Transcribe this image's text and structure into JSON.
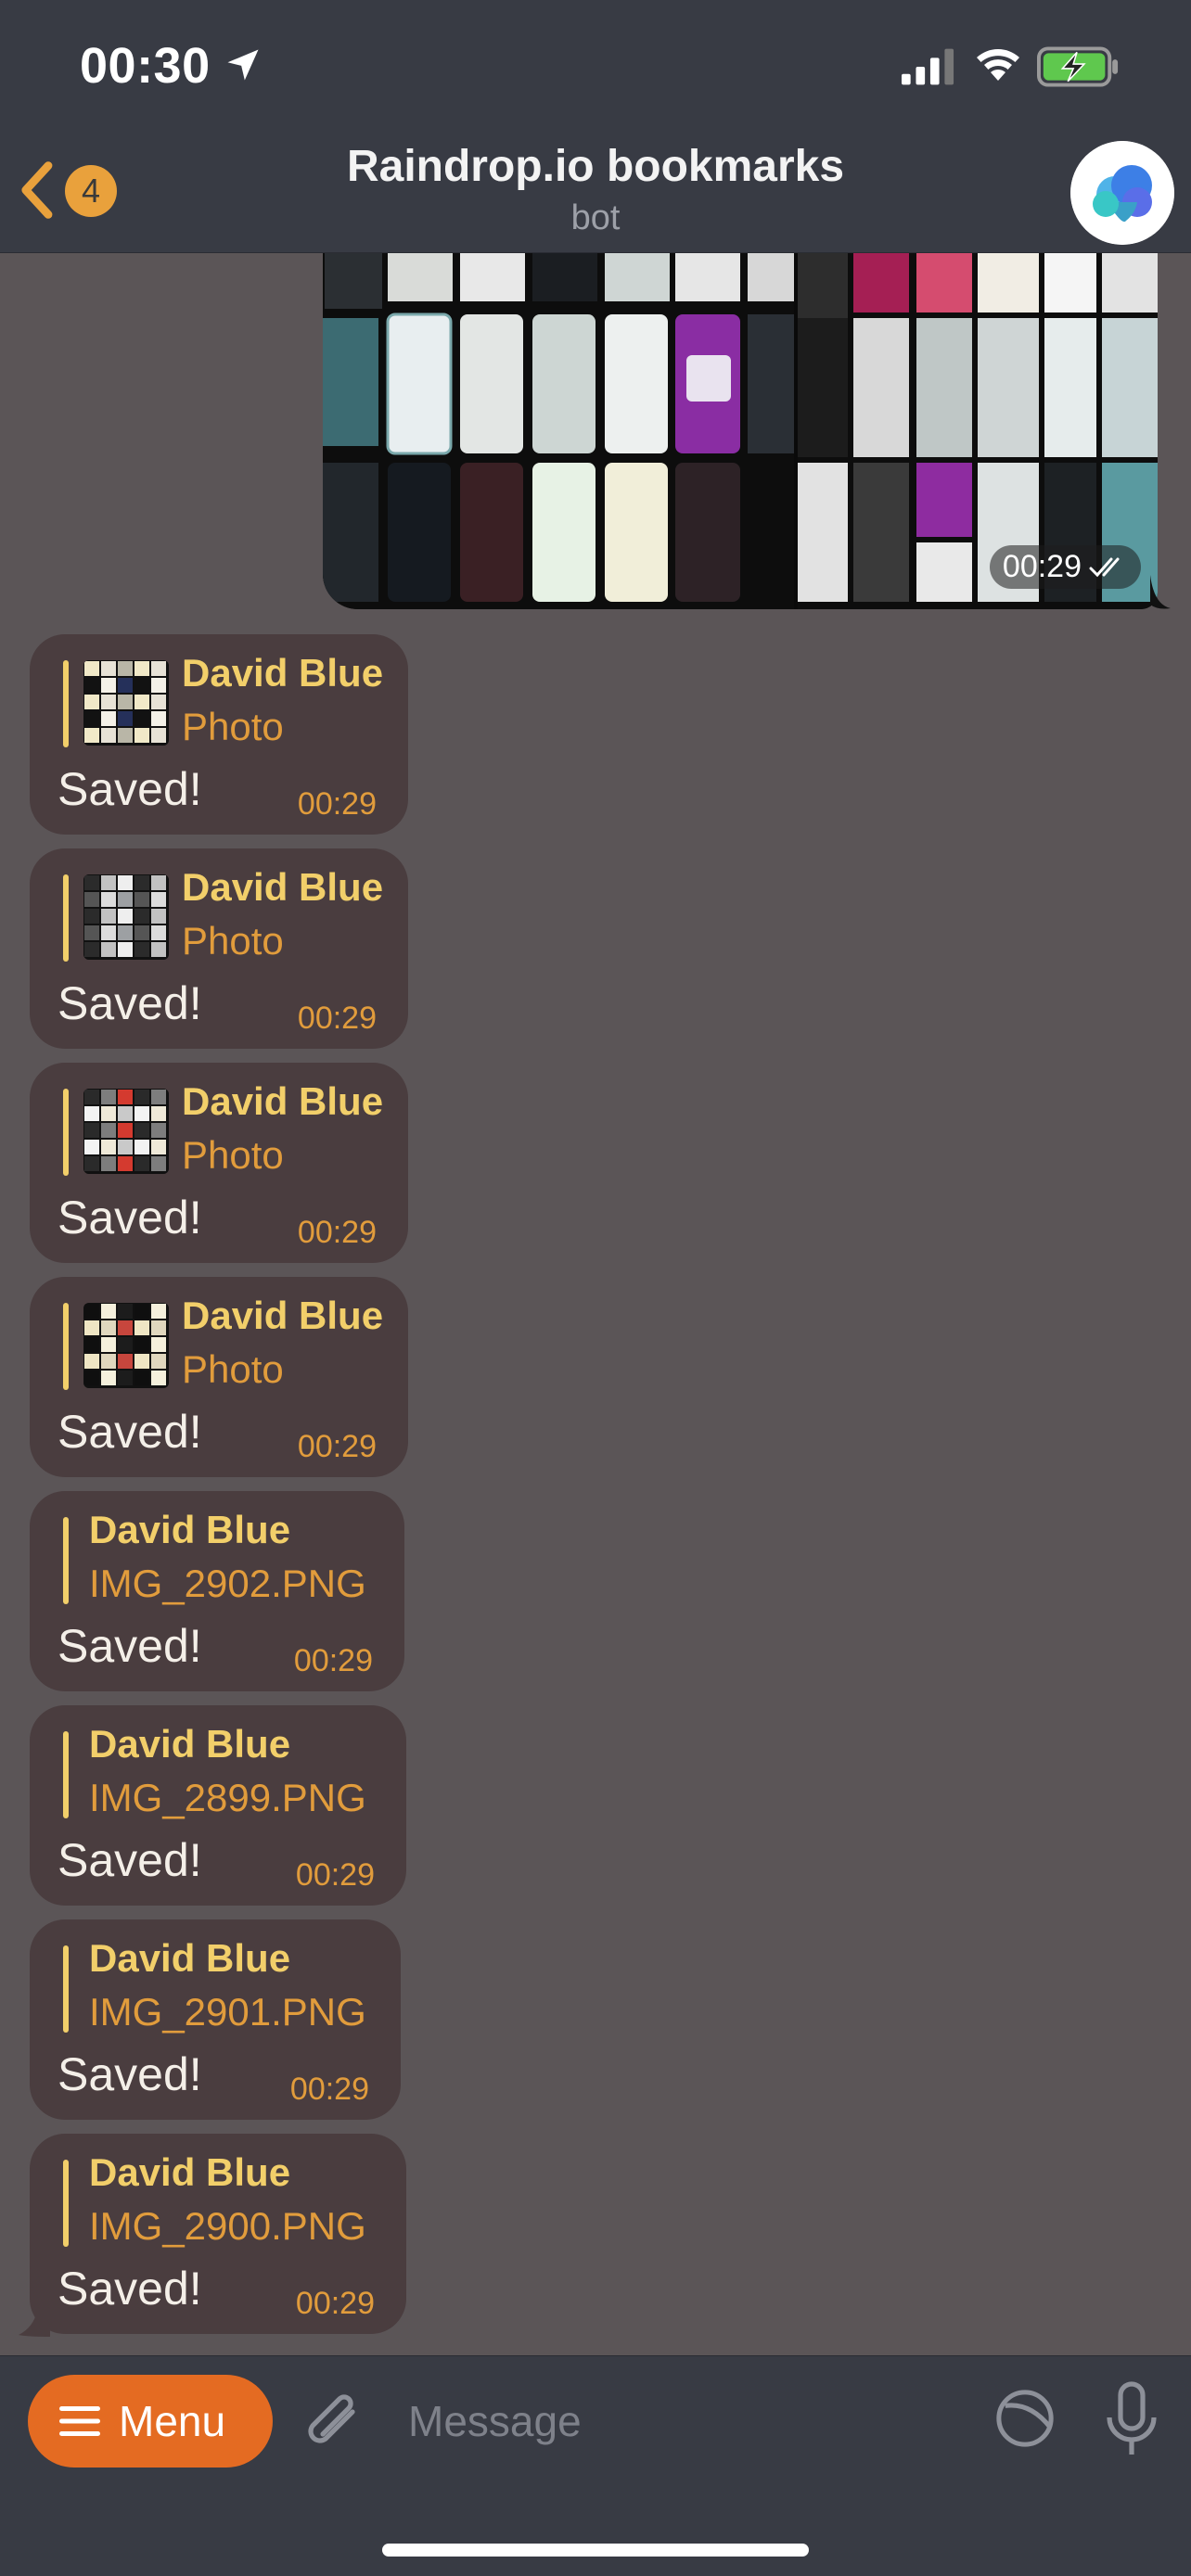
{
  "status_bar": {
    "time": "00:30",
    "icons": [
      "location-arrow-icon",
      "signal-icon",
      "wifi-icon",
      "battery-charging-icon"
    ]
  },
  "header": {
    "back_badge": "4",
    "title": "Raindrop.io bookmarks",
    "subtitle": "bot",
    "avatar_icon": "raindrop-cloud-icon"
  },
  "photo_message": {
    "time": "00:29",
    "status_icon": "double-check-icon"
  },
  "messages": [
    {
      "reply_name": "David Blue",
      "reply_sub": "Photo",
      "text": "Saved!",
      "time": "00:29",
      "has_thumb": true
    },
    {
      "reply_name": "David Blue",
      "reply_sub": "Photo",
      "text": "Saved!",
      "time": "00:29",
      "has_thumb": true
    },
    {
      "reply_name": "David Blue",
      "reply_sub": "Photo",
      "text": "Saved!",
      "time": "00:29",
      "has_thumb": true
    },
    {
      "reply_name": "David Blue",
      "reply_sub": "Photo",
      "text": "Saved!",
      "time": "00:29",
      "has_thumb": true
    },
    {
      "reply_name": "David Blue",
      "reply_sub": "IMG_2902.PNG",
      "text": "Saved!",
      "time": "00:29",
      "has_thumb": false
    },
    {
      "reply_name": "David Blue",
      "reply_sub": "IMG_2899.PNG",
      "text": "Saved!",
      "time": "00:29",
      "has_thumb": false
    },
    {
      "reply_name": "David Blue",
      "reply_sub": "IMG_2901.PNG",
      "text": "Saved!",
      "time": "00:29",
      "has_thumb": false
    },
    {
      "reply_name": "David Blue",
      "reply_sub": "IMG_2900.PNG",
      "text": "Saved!",
      "time": "00:29",
      "has_thumb": false
    }
  ],
  "composer": {
    "menu_label": "Menu",
    "placeholder": "Message"
  },
  "colors": {
    "background": "#5b5557",
    "bar": "#383b44",
    "bubble": "#4a3d3f",
    "accent": "#e46b22",
    "reply_name": "#f2cf6a",
    "reply_sub": "#e19c3c"
  }
}
